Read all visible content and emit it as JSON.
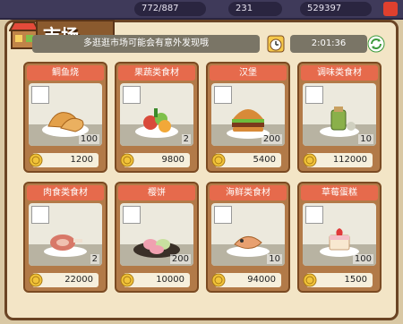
{
  "topbar": {
    "stats": [
      "772/887",
      "231",
      "529397"
    ]
  },
  "header": {
    "title": "市场",
    "banner": "多逛逛市场可能会有意外发现哦",
    "timer": "2:01:36"
  },
  "colors": {
    "panel_bg": "#f3e5c6",
    "card_bg": "#b27a48",
    "name_bar": "#e66a4c",
    "banner_bg": "#7a7566",
    "coin": "#f2c43a"
  },
  "items": [
    {
      "name": "鲷鱼烧",
      "qty": "100",
      "price": "1200",
      "icon": "taiyaki-icon"
    },
    {
      "name": "果蔬类食材",
      "qty": "2",
      "price": "9800",
      "icon": "vegetables-icon"
    },
    {
      "name": "汉堡",
      "qty": "200",
      "price": "5400",
      "icon": "burger-icon"
    },
    {
      "name": "调味类食材",
      "qty": "10",
      "price": "112000",
      "icon": "seasoning-icon"
    },
    {
      "name": "肉食类食材",
      "qty": "2",
      "price": "22000",
      "icon": "meat-icon"
    },
    {
      "name": "樱饼",
      "qty": "200",
      "price": "10000",
      "icon": "sakura-cake-icon"
    },
    {
      "name": "海鲜类食材",
      "qty": "10",
      "price": "94000",
      "icon": "seafood-icon"
    },
    {
      "name": "草莓蛋糕",
      "qty": "100",
      "price": "1500",
      "icon": "strawberry-cake-icon"
    }
  ]
}
